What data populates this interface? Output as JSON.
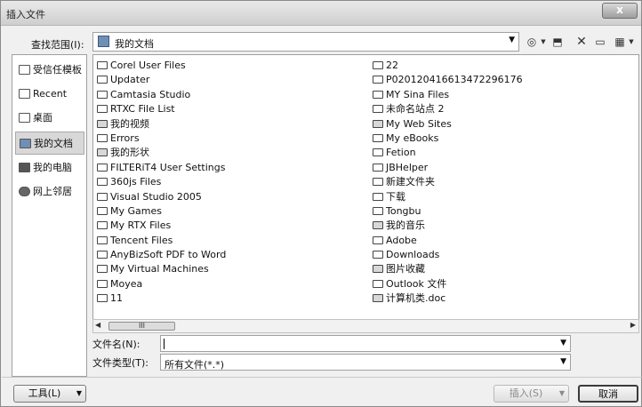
{
  "window": {
    "title": "插入文件",
    "close_label": "x"
  },
  "lookin": {
    "label": "查找范围(I):",
    "value": "我的文档"
  },
  "places": [
    {
      "label": "受信任模板",
      "name": "trusted-templates"
    },
    {
      "label": "Recent",
      "name": "recent"
    },
    {
      "label": "桌面",
      "name": "desktop"
    },
    {
      "label": "我的文档",
      "name": "my-documents",
      "selected": true
    },
    {
      "label": "我的电脑",
      "name": "my-computer"
    },
    {
      "label": "网上邻居",
      "name": "network-places"
    }
  ],
  "files_col1": [
    {
      "label": "Corel User Files",
      "icon": "folder-icon"
    },
    {
      "label": "Updater",
      "icon": "folder-icon"
    },
    {
      "label": "Camtasia Studio",
      "icon": "folder-icon"
    },
    {
      "label": "RTXC File List",
      "icon": "folder-icon"
    },
    {
      "label": "我的视频",
      "icon": "video-folder-icon"
    },
    {
      "label": "Errors",
      "icon": "folder-icon"
    },
    {
      "label": "我的形状",
      "icon": "shapes-folder-icon"
    },
    {
      "label": "FILTERiT4 User Settings",
      "icon": "folder-icon"
    },
    {
      "label": "360js Files",
      "icon": "folder-icon"
    },
    {
      "label": "Visual Studio 2005",
      "icon": "folder-icon"
    },
    {
      "label": "My Games",
      "icon": "folder-icon"
    },
    {
      "label": "My RTX Files",
      "icon": "folder-icon"
    },
    {
      "label": "Tencent Files",
      "icon": "folder-icon"
    },
    {
      "label": "AnyBizSoft PDF to Word",
      "icon": "folder-icon"
    },
    {
      "label": "My Virtual Machines",
      "icon": "folder-icon"
    },
    {
      "label": "Moyea",
      "icon": "folder-icon"
    },
    {
      "label": "11",
      "icon": "folder-icon"
    }
  ],
  "files_col2": [
    {
      "label": "22",
      "icon": "folder-icon"
    },
    {
      "label": "P020120416613472296176",
      "icon": "folder-icon"
    },
    {
      "label": "MY Sina Files",
      "icon": "folder-icon"
    },
    {
      "label": "未命名站点 2",
      "icon": "folder-icon"
    },
    {
      "label": "My Web Sites",
      "icon": "web-folder-icon"
    },
    {
      "label": "My eBooks",
      "icon": "folder-icon"
    },
    {
      "label": "Fetion",
      "icon": "folder-icon"
    },
    {
      "label": "JBHelper",
      "icon": "folder-icon"
    },
    {
      "label": "新建文件夹",
      "icon": "folder-icon"
    },
    {
      "label": "下载",
      "icon": "folder-icon"
    },
    {
      "label": "Tongbu",
      "icon": "folder-icon"
    },
    {
      "label": "我的音乐",
      "icon": "music-folder-icon"
    },
    {
      "label": "Adobe",
      "icon": "folder-icon"
    },
    {
      "label": "Downloads",
      "icon": "folder-icon"
    },
    {
      "label": "图片收藏",
      "icon": "pictures-folder-icon"
    },
    {
      "label": "Outlook 文件",
      "icon": "folder-icon"
    },
    {
      "label": "计算机类.doc",
      "icon": "doc-file-icon"
    }
  ],
  "scrollbar": {
    "thumb_grip": "III"
  },
  "filename": {
    "label": "文件名(N):",
    "value": ""
  },
  "filetype": {
    "label": "文件类型(T):",
    "value": "所有文件(*.*)"
  },
  "buttons": {
    "tools": "工具(L)",
    "insert": "插入(S)",
    "cancel": "取消"
  }
}
